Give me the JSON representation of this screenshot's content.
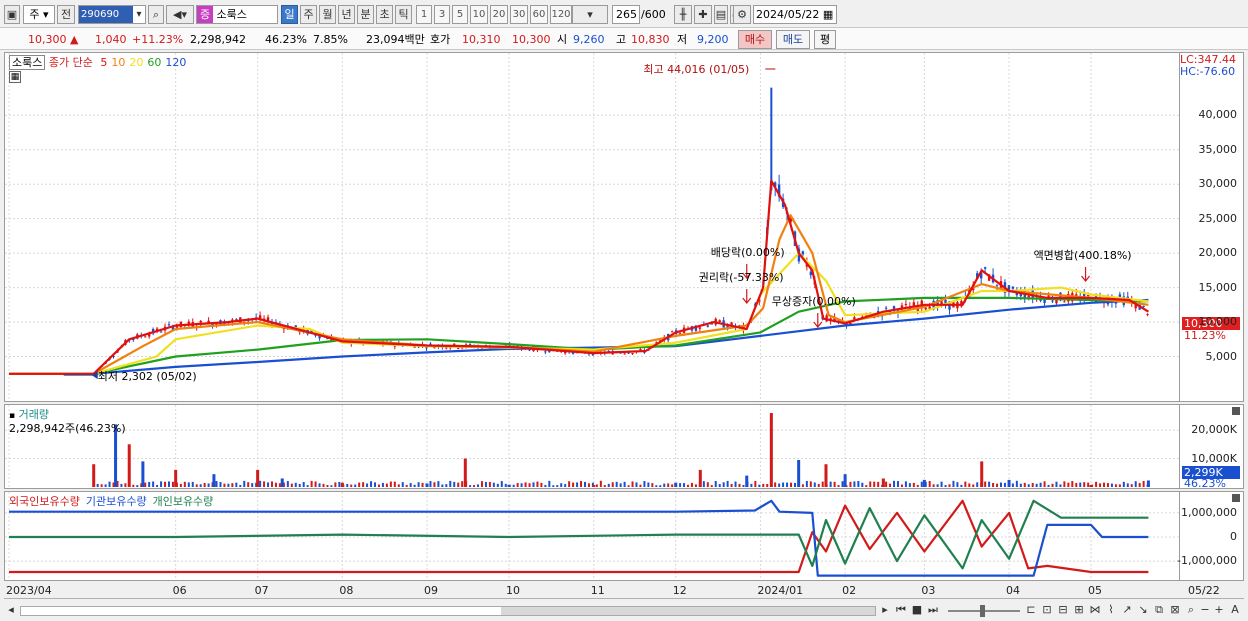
{
  "toolbar": {
    "market": "주",
    "prev": "전",
    "code": "290690",
    "group_badge": "증",
    "stock_name": "소룩스",
    "periods": [
      "일",
      "주",
      "월",
      "년",
      "분",
      "초",
      "틱"
    ],
    "intervals": [
      "1",
      "3",
      "5",
      "10",
      "20",
      "30",
      "60",
      "120"
    ],
    "count": "265",
    "count_total": "/600",
    "date": "2024/05/22"
  },
  "quote": {
    "price": "10,300",
    "change": "1,040",
    "change_pct": "+11.23%",
    "volume": "2,298,942",
    "vol_ratio": "46.23%",
    "turnover": "7.85%",
    "amount": "23,094백만",
    "bid_label": "호가",
    "bid1": "10,310",
    "bid2": "10,300",
    "open_label": "시",
    "open": "9,260",
    "high_label": "고",
    "high": "10,830",
    "low_label": "저",
    "low": "9,200",
    "buy": "매수",
    "sell": "매도",
    "eval": "평"
  },
  "chart_data": [
    {
      "type": "line",
      "panel": "price",
      "legend": {
        "name": "소룩스",
        "label": "종가 단순",
        "periods": [
          {
            "name": "5",
            "color": "#e01010"
          },
          {
            "name": "10",
            "color": "#f08010"
          },
          {
            "name": "20",
            "color": "#f0e020"
          },
          {
            "name": "60",
            "color": "#20a020"
          },
          {
            "name": "120",
            "color": "#1a4fd0"
          }
        ]
      },
      "ylim": [
        0,
        47000
      ],
      "yticks": [
        "5,000",
        "10,000",
        "15,000",
        "20,000",
        "25,000",
        "30,000",
        "35,000",
        "40,000"
      ],
      "lc": "LC:347.44",
      "hc": "HC:-76.60",
      "last_price_tag": "10,300",
      "last_pct_tag": "11.23%",
      "annotations": [
        {
          "text": "최고 44,016 (01/05)",
          "x": "2024-01-05",
          "y": 44016
        },
        {
          "text": "최저 2,302 (05/02)",
          "x": "2023-05-02",
          "y": 2302
        },
        {
          "text": "배당락(0.00%)",
          "x": "2023-12-27"
        },
        {
          "text": "권리락(-57.33%)",
          "x": "2023-12-27"
        },
        {
          "text": "무상증자(0.00%)",
          "x": "2024-01-22"
        },
        {
          "text": "액면병합(400.18%)",
          "x": "2024-04-29"
        }
      ],
      "series": [
        {
          "name": "5",
          "color": "#e01010",
          "x": [
            "2023-04",
            "2023-05-02",
            "2023-05-15",
            "2023-06",
            "2023-06-20",
            "2023-07",
            "2023-07-20",
            "2023-08",
            "2023-09",
            "2023-10",
            "2023-11",
            "2023-11-20",
            "2023-12",
            "2023-12-15",
            "2023-12-27",
            "2024-01-02",
            "2024-01-05",
            "2024-01-10",
            "2024-01-15",
            "2024-01-20",
            "2024-01-24",
            "2024-02",
            "2024-02-15",
            "2024-03",
            "2024-03-15",
            "2024-03-22",
            "2024-04",
            "2024-04-15",
            "2024-05",
            "2024-05-15",
            "2024-05-22"
          ],
          "values": [
            2500,
            2500,
            7500,
            9500,
            10000,
            10500,
            8500,
            7200,
            6600,
            6400,
            5500,
            5800,
            8500,
            10000,
            9000,
            15000,
            30500,
            27000,
            20000,
            17500,
            10500,
            9800,
            11500,
            12500,
            12500,
            17500,
            14500,
            13500,
            13500,
            13200,
            11500
          ]
        },
        {
          "name": "10",
          "color": "#f08010",
          "x": [
            "2023-04",
            "2023-05-02",
            "2023-05-20",
            "2023-06",
            "2023-07",
            "2023-08",
            "2023-09",
            "2023-10",
            "2023-11",
            "2023-12",
            "2023-12-27",
            "2024-01-02",
            "2024-01-08",
            "2024-01-12",
            "2024-01-20",
            "2024-01-26",
            "2024-02",
            "2024-03",
            "2024-03-22",
            "2024-04",
            "2024-05",
            "2024-05-22"
          ],
          "values": [
            2500,
            2500,
            6500,
            9000,
            10000,
            7500,
            6600,
            6400,
            5700,
            8000,
            9500,
            12000,
            22000,
            25500,
            20000,
            11000,
            10000,
            12200,
            15500,
            14500,
            13500,
            12500
          ]
        },
        {
          "name": "20",
          "color": "#f0e020",
          "x": [
            "2023-04",
            "2023-05-02",
            "2023-05-25",
            "2023-06",
            "2023-07",
            "2023-07-20",
            "2023-08",
            "2023-09",
            "2023-10",
            "2023-11",
            "2023-12",
            "2023-12-27",
            "2024-01",
            "2024-01-15",
            "2024-01-25",
            "2024-02",
            "2024-03",
            "2024-03-22",
            "2024-04",
            "2024-04-20",
            "2024-05",
            "2024-05-22"
          ],
          "values": [
            2500,
            2500,
            5000,
            7500,
            9500,
            9000,
            7000,
            6500,
            6300,
            6000,
            7000,
            9000,
            14000,
            20000,
            16000,
            11000,
            11500,
            14500,
            14500,
            15000,
            14000,
            13000
          ]
        },
        {
          "name": "60",
          "color": "#20a020",
          "x": [
            "2023-04",
            "2023-05-02",
            "2023-06",
            "2023-07",
            "2023-08",
            "2023-09",
            "2023-10",
            "2023-11",
            "2023-12",
            "2024-01",
            "2024-01-15",
            "2024-02",
            "2024-03",
            "2024-04",
            "2024-05",
            "2024-05-22"
          ],
          "values": [
            2500,
            2500,
            5000,
            6000,
            7400,
            7500,
            6800,
            6000,
            6600,
            8500,
            11500,
            13000,
            13500,
            13500,
            13200,
            13000
          ]
        },
        {
          "name": "120",
          "color": "#1a4fd0",
          "x": [
            "2023-04",
            "2023-05-02",
            "2023-06",
            "2023-07",
            "2023-08",
            "2023-09",
            "2023-10",
            "2023-11",
            "2023-12",
            "2024-01",
            "2024-02",
            "2024-03",
            "2024-04",
            "2024-05",
            "2024-05-22"
          ],
          "values": [
            2500,
            2500,
            3500,
            4200,
            5000,
            5600,
            6100,
            6300,
            6500,
            8000,
            9500,
            10500,
            11800,
            12800,
            13200
          ]
        }
      ]
    },
    {
      "type": "bar",
      "panel": "volume",
      "title": "거래량",
      "current": "2,298,942주(46.23%)",
      "ylim": [
        0,
        26000
      ],
      "yticks": [
        "10,000K",
        "20,000K"
      ],
      "last_tag": "2,299K",
      "last_pct_tag": "46.23%",
      "categories": [
        "2023-05-02",
        "2023-05-10",
        "2023-05-15",
        "2023-05-20",
        "2023-06",
        "2023-06-15",
        "2023-07",
        "2023-07-10",
        "2023-08",
        "2023-09",
        "2023-09-15",
        "2023-10",
        "2023-11",
        "2023-12",
        "2023-12-10",
        "2023-12-27",
        "2024-01-05",
        "2024-01-15",
        "2024-01-25",
        "2024-02",
        "2024-02-15",
        "2024-03",
        "2024-03-22",
        "2024-04",
        "2024-05",
        "2024-05-22"
      ],
      "values": [
        8000,
        22000,
        15000,
        9000,
        6000,
        4500,
        6000,
        3000,
        1500,
        1200,
        10000,
        800,
        700,
        1500,
        6000,
        4000,
        26000,
        9500,
        8000,
        4500,
        3000,
        2500,
        9000,
        2500,
        700,
        2300
      ]
    },
    {
      "type": "line",
      "panel": "holdings",
      "legend": [
        "외국인보유수량",
        "기관보유수량",
        "개인보유수량"
      ],
      "legend_colors": [
        "#d21a1a",
        "#1a4fd0",
        "#208050"
      ],
      "ylim": [
        -1700000,
        1700000
      ],
      "yticks": [
        "1,000,000",
        "0",
        "-1,000,000"
      ],
      "series": [
        {
          "name": "외국인보유수량",
          "color": "#d21a1a",
          "x": [
            "2023-04",
            "2023-06",
            "2023-08",
            "2023-10",
            "2023-12",
            "2024-01",
            "2024-01-15",
            "2024-01-20",
            "2024-01-25",
            "2024-02",
            "2024-02-10",
            "2024-02-20",
            "2024-03",
            "2024-03-15",
            "2024-03-22",
            "2024-04",
            "2024-04-08",
            "2024-04-15",
            "2024-05",
            "2024-05-22"
          ],
          "values": [
            -1450000,
            -1450000,
            -1450000,
            -1450000,
            -1450000,
            -1450000,
            -1450000,
            200000,
            -600000,
            1300000,
            -500000,
            1000000,
            -600000,
            1500000,
            -400000,
            1000000,
            -1300000,
            -1200000,
            -1450000,
            -1450000
          ]
        },
        {
          "name": "기관보유수량",
          "color": "#1a4fd0",
          "x": [
            "2023-04",
            "2023-07",
            "2023-10",
            "2023-12",
            "2023-12-30",
            "2024-01-05",
            "2024-01-08",
            "2024-01-20",
            "2024-01-22",
            "2024-02",
            "2024-03",
            "2024-04",
            "2024-04-10",
            "2024-04-15",
            "2024-05",
            "2024-05-05",
            "2024-05-22"
          ],
          "values": [
            1050000,
            1050000,
            1050000,
            1050000,
            1100000,
            1500000,
            1050000,
            1000000,
            -1600000,
            -1600000,
            -1600000,
            -1600000,
            -1600000,
            500000,
            500000,
            0,
            0
          ]
        },
        {
          "name": "개인보유수량",
          "color": "#208050",
          "x": [
            "2023-04",
            "2023-06",
            "2023-08",
            "2023-10",
            "2023-12",
            "2024-01",
            "2024-01-15",
            "2024-01-20",
            "2024-01-25",
            "2024-02",
            "2024-02-10",
            "2024-02-20",
            "2024-03",
            "2024-03-15",
            "2024-03-22",
            "2024-04",
            "2024-04-10",
            "2024-04-20",
            "2024-05",
            "2024-05-22"
          ],
          "values": [
            0,
            0,
            100000,
            0,
            100000,
            100000,
            100000,
            -1200000,
            700000,
            -1100000,
            1200000,
            -1000000,
            900000,
            -1300000,
            700000,
            -900000,
            1500000,
            800000,
            800000,
            800000
          ]
        }
      ]
    }
  ],
  "xaxis": {
    "labels": [
      {
        "text": "2023/04",
        "date": "2023-04-01"
      },
      {
        "text": "06",
        "date": "2023-06-01"
      },
      {
        "text": "07",
        "date": "2023-07-01"
      },
      {
        "text": "08",
        "date": "2023-08-01"
      },
      {
        "text": "09",
        "date": "2023-09-01"
      },
      {
        "text": "10",
        "date": "2023-10-01"
      },
      {
        "text": "11",
        "date": "2023-11-01"
      },
      {
        "text": "12",
        "date": "2023-12-01"
      },
      {
        "text": "2024/01",
        "date": "2024-01-01"
      },
      {
        "text": "02",
        "date": "2024-02-01"
      },
      {
        "text": "03",
        "date": "2024-03-01"
      },
      {
        "text": "04",
        "date": "2024-04-01"
      },
      {
        "text": "05",
        "date": "2024-05-01"
      }
    ],
    "right_label": "05/22",
    "range": [
      "2023-04-01",
      "2024-05-31"
    ]
  }
}
